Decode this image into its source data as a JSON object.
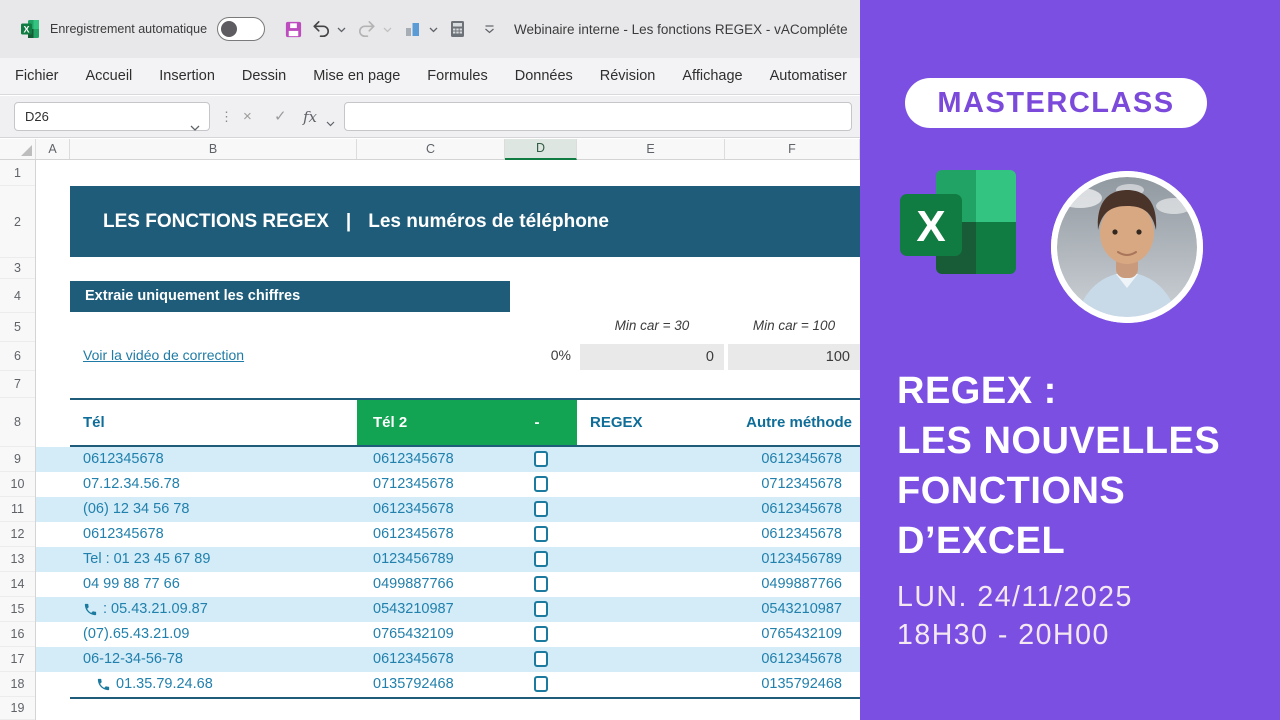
{
  "window": {
    "titlebar": {
      "autosave_label": "Enregistrement automatique",
      "autosave_state": "off",
      "doc_title": "Webinaire interne - Les fonctions REGEX - vACompléte"
    },
    "ribbon_tabs": [
      "Fichier",
      "Accueil",
      "Insertion",
      "Dessin",
      "Mise en page",
      "Formules",
      "Données",
      "Révision",
      "Affichage",
      "Automatiser"
    ],
    "formula_bar": {
      "name_box": "D26",
      "separator_glyph": "⋮",
      "cancel_glyph": "×",
      "enter_glyph": "✓",
      "fx_glyph": "fx",
      "formula_value": ""
    }
  },
  "sheet": {
    "column_headers": [
      "A",
      "B",
      "C",
      "D",
      "E",
      "F"
    ],
    "selected_column": "D",
    "row_numbers": [
      "1",
      "2",
      "3",
      "4",
      "5",
      "6",
      "7",
      "8",
      "9",
      "10",
      "11",
      "12",
      "13",
      "14",
      "15",
      "16",
      "17",
      "18",
      "19"
    ],
    "title_banner": {
      "part1": "LES FONCTIONS REGEX",
      "separator": "|",
      "part2": "Les numéros de téléphone"
    },
    "section_banner": "Extraie uniquement les chiffres",
    "correction_link": "Voir la vidéo de correction",
    "progress_value": "0%",
    "thresholds": {
      "label_30": "Min car = 30",
      "label_100": "Min car = 100",
      "value_30": "0",
      "value_100": "100"
    },
    "table": {
      "headers": {
        "tel": "Tél",
        "tel2": "Tél 2",
        "dash": "-",
        "regex": "REGEX",
        "autre": "Autre méthode"
      },
      "rows": [
        {
          "tel": "0612345678",
          "tel2": "0612345678",
          "autre": "0612345678",
          "phone_icon": false,
          "indent": false,
          "checked": false
        },
        {
          "tel": "07.12.34.56.78",
          "tel2": "0712345678",
          "autre": "0712345678",
          "phone_icon": false,
          "indent": false,
          "checked": false
        },
        {
          "tel": "(06) 12 34 56 78",
          "tel2": "0612345678",
          "autre": "0612345678",
          "phone_icon": false,
          "indent": false,
          "checked": false
        },
        {
          "tel": "0612345678",
          "tel2": "0612345678",
          "autre": "0612345678",
          "phone_icon": false,
          "indent": false,
          "checked": false
        },
        {
          "tel": "Tel : 01 23 45 67 89",
          "tel2": "0123456789",
          "autre": "0123456789",
          "phone_icon": false,
          "indent": false,
          "checked": false
        },
        {
          "tel": "04 99 88 77 66",
          "tel2": "0499887766",
          "autre": "0499887766",
          "phone_icon": false,
          "indent": false,
          "checked": false
        },
        {
          "tel": ": 05.43.21.09.87",
          "tel2": "0543210987",
          "autre": "0543210987",
          "phone_icon": true,
          "indent": false,
          "checked": false
        },
        {
          "tel": "(07).65.43.21.09",
          "tel2": "0765432109",
          "autre": "0765432109",
          "phone_icon": false,
          "indent": false,
          "checked": false
        },
        {
          "tel": "06-12-34-56-78",
          "tel2": "0612345678",
          "autre": "0612345678",
          "phone_icon": false,
          "indent": false,
          "checked": false
        },
        {
          "tel": "01.35.79.24.68",
          "tel2": "0135792468",
          "autre": "0135792468",
          "phone_icon": true,
          "indent": true,
          "checked": false
        }
      ]
    }
  },
  "promo": {
    "badge": "MASTERCLASS",
    "headline_lines": [
      "REGEX :",
      "LES NOUVELLES",
      "FONCTIONS",
      "D’EXCEL"
    ],
    "date_line1": "LUN. 24/11/2025",
    "date_line2": "18H30 - 20H00"
  },
  "icons": {
    "excel_app_icon": "excel-logo",
    "autosave_toggle": "toggle-off",
    "save_icon": "floppy-disk",
    "undo_icon": "arrow-undo",
    "redo_icon": "arrow-redo",
    "chart_icon": "bar-chart",
    "calculator_icon": "calculator",
    "qat_customize_icon": "chevron-down-with-line",
    "phone_icon": "phone-receiver",
    "checkbox": "empty-checkbox"
  },
  "colors": {
    "panel_purple": "#7C4FE3",
    "badge_text_purple": "#7C4ADB",
    "banner_teal": "#1E5C7A",
    "table_green": "#12A452",
    "stripe_blue": "#D3ECF8",
    "value_blue": "#2180AC",
    "link_teal": "#1F7BA6",
    "save_icon_magenta": "#BD4DBF",
    "selected_column_green": "#107C41"
  }
}
